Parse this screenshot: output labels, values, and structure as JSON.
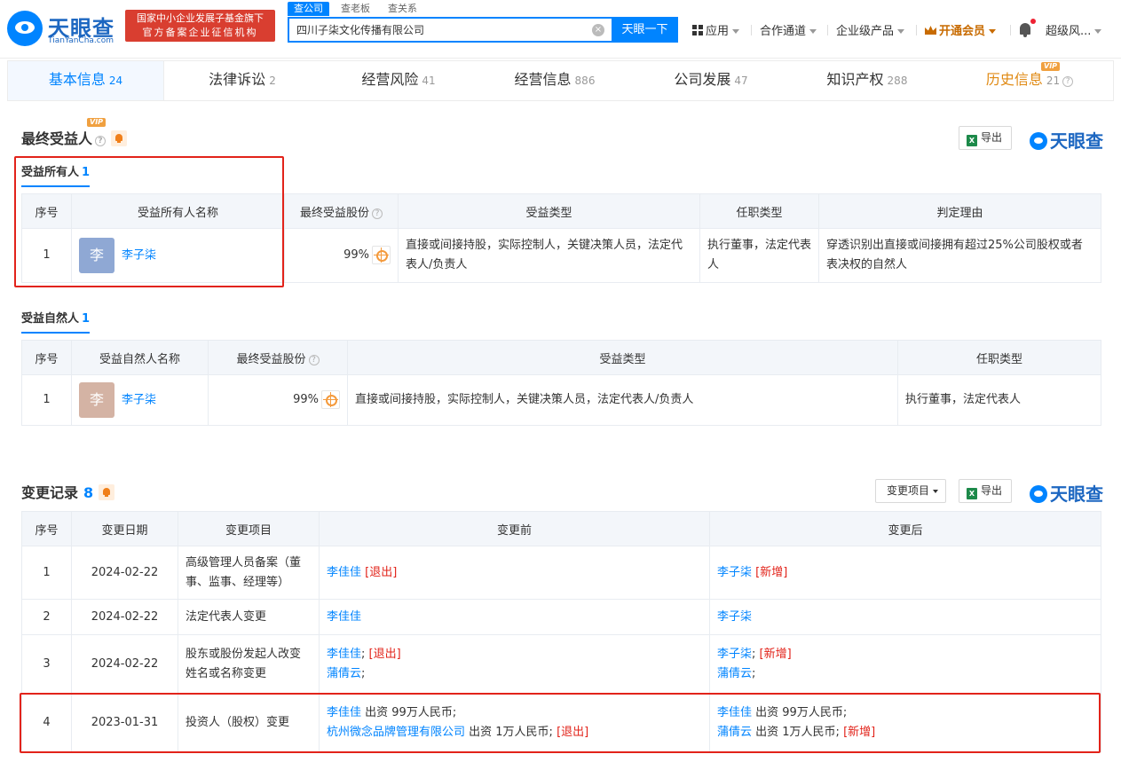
{
  "brand": {
    "name_cn": "天眼查",
    "name_en": "TianYanCha.com",
    "badge_line1": "国家中小企业发展子基金旗下",
    "badge_line2": "官方备案企业征信机构"
  },
  "search": {
    "tabs": [
      "查公司",
      "查老板",
      "查关系"
    ],
    "value": "四川子柒文化传播有限公司",
    "button": "天眼一下",
    "clear_icon": "×"
  },
  "topnav": {
    "apps": "应用",
    "channel": "合作通道",
    "enterprise": "企业级产品",
    "vip": "开通会员",
    "user": "超级风..."
  },
  "tabs": [
    {
      "label": "基本信息",
      "count": "24"
    },
    {
      "label": "法律诉讼",
      "count": "2"
    },
    {
      "label": "经营风险",
      "count": "41"
    },
    {
      "label": "经营信息",
      "count": "886"
    },
    {
      "label": "公司发展",
      "count": "47"
    },
    {
      "label": "知识产权",
      "count": "288"
    },
    {
      "label": "历史信息",
      "count": "21",
      "vip": "VIP"
    }
  ],
  "beneficiary": {
    "title": "最终受益人",
    "vip": "VIP",
    "export": "导出",
    "brand": "天眼查",
    "owner": {
      "subtitle": "受益所有人",
      "count": "1",
      "headers": [
        "序号",
        "受益所有人名称",
        "最终受益股份",
        "受益类型",
        "任职类型",
        "判定理由"
      ],
      "rows": [
        {
          "no": "1",
          "avatar": "李",
          "name": "李子柒",
          "share": "99%",
          "type": "直接或间接持股，实际控制人，关键决策人员，法定代表人/负责人",
          "position": "执行董事，法定代表人",
          "reason": "穿透识别出直接或间接拥有超过25%公司股权或者表决权的自然人"
        }
      ]
    },
    "natural": {
      "subtitle": "受益自然人",
      "count": "1",
      "headers": [
        "序号",
        "受益自然人名称",
        "最终受益股份",
        "受益类型",
        "任职类型"
      ],
      "rows": [
        {
          "no": "1",
          "avatar": "李",
          "name": "李子柒",
          "share": "99%",
          "type": "直接或间接持股，实际控制人，关键决策人员，法定代表人/负责人",
          "position": "执行董事，法定代表人"
        }
      ]
    }
  },
  "changes": {
    "title": "变更记录",
    "count": "8",
    "filter": "变更项目",
    "export": "导出",
    "brand": "天眼查",
    "headers": [
      "序号",
      "变更日期",
      "变更项目",
      "变更前",
      "变更后"
    ],
    "rows": [
      {
        "no": "1",
        "date": "2024-02-22",
        "item": "高级管理人员备案（董事、监事、经理等）",
        "before": [
          {
            "parts": [
              {
                "t": "李佳佳",
                "k": "link"
              },
              {
                "t": " [退出]",
                "k": "red"
              }
            ]
          }
        ],
        "after": [
          {
            "parts": [
              {
                "t": "李子柒",
                "k": "link"
              },
              {
                "t": " [新增]",
                "k": "red"
              }
            ]
          }
        ]
      },
      {
        "no": "2",
        "date": "2024-02-22",
        "item": "法定代表人变更",
        "before": [
          {
            "parts": [
              {
                "t": "李佳佳",
                "k": "link"
              }
            ]
          }
        ],
        "after": [
          {
            "parts": [
              {
                "t": "李子柒",
                "k": "link"
              }
            ]
          }
        ]
      },
      {
        "no": "3",
        "date": "2024-02-22",
        "item": "股东或股份发起人改变姓名或名称变更",
        "before": [
          {
            "parts": [
              {
                "t": "李佳佳",
                "k": "link"
              },
              {
                "t": ";",
                "k": "plain"
              },
              {
                "t": " [退出]",
                "k": "red"
              }
            ]
          },
          {
            "parts": [
              {
                "t": "蒲倩云",
                "k": "link"
              },
              {
                "t": ";",
                "k": "plain"
              }
            ]
          }
        ],
        "after": [
          {
            "parts": [
              {
                "t": "李子柒",
                "k": "link"
              },
              {
                "t": ";",
                "k": "plain"
              },
              {
                "t": " [新增]",
                "k": "red"
              }
            ]
          },
          {
            "parts": [
              {
                "t": "蒲倩云",
                "k": "link"
              },
              {
                "t": ";",
                "k": "plain"
              }
            ]
          }
        ]
      },
      {
        "no": "4",
        "date": "2023-01-31",
        "item": "投资人（股权）变更",
        "before": [
          {
            "parts": [
              {
                "t": "李佳佳",
                "k": "link"
              },
              {
                "t": " 出资 99万人民币;",
                "k": "plain"
              }
            ]
          },
          {
            "parts": [
              {
                "t": "杭州微念品牌管理有限公司",
                "k": "link"
              },
              {
                "t": " 出资 1万人民币;",
                "k": "plain"
              },
              {
                "t": " [退出]",
                "k": "red"
              }
            ]
          }
        ],
        "after": [
          {
            "parts": [
              {
                "t": "李佳佳",
                "k": "link"
              },
              {
                "t": " 出资 99万人民币;",
                "k": "plain"
              }
            ]
          },
          {
            "parts": [
              {
                "t": "蒲倩云",
                "k": "link"
              },
              {
                "t": " 出资 1万人民币;",
                "k": "plain"
              },
              {
                "t": " [新增]",
                "k": "red"
              }
            ]
          }
        ]
      }
    ]
  },
  "colors": {
    "accent": "#0084ff",
    "red": "#e2231a",
    "avatar1": "#8fa8d4",
    "avatar2": "#d4b3a4",
    "header_bg": "#f3f6fa"
  }
}
